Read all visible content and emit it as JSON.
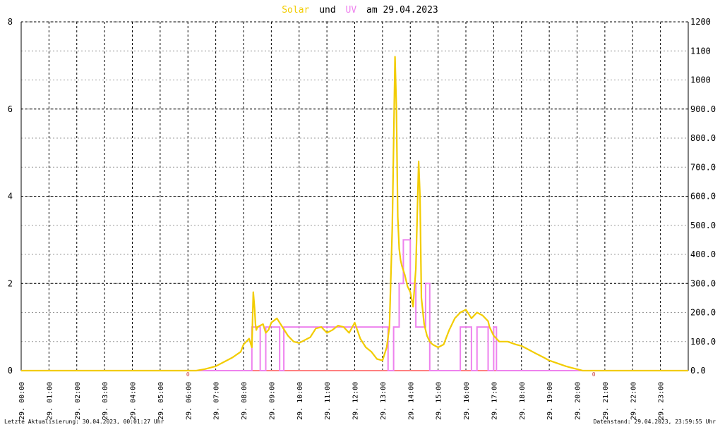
{
  "title": {
    "word1": "Solar",
    "word2": "und",
    "word3": "UV",
    "word4": "am 29.04.2023"
  },
  "footer": {
    "left": "Letzte Aktualisierung: 30.04.2023, 00:01:27 Uhr",
    "right": "Datenstand: 29.04.2023, 23:59:55 Uhr"
  },
  "colors": {
    "solar": "#f2cc00",
    "uv": "#ee82ee",
    "grid": "#000000",
    "baseline": "#ff8080",
    "title_neutral": "#000000"
  },
  "chart_data": {
    "type": "line",
    "title": "Solar und UV am 29.04.2023",
    "x_unit": "hour of day",
    "xlim": [
      0,
      24
    ],
    "x_tick_labels": [
      "29. 00:00",
      "29. 01:00",
      "29. 02:00",
      "29. 03:00",
      "29. 04:00",
      "29. 05:00",
      "29. 06:00",
      "29. 07:00",
      "29. 08:00",
      "29. 09:00",
      "29. 10:00",
      "29. 11:00",
      "29. 12:00",
      "29. 13:00",
      "29. 14:00",
      "29. 15:00",
      "29. 16:00",
      "29. 17:00",
      "29. 18:00",
      "29. 19:00",
      "29. 20:00",
      "29. 21:00",
      "29. 22:00",
      "29. 23:00"
    ],
    "left_axis": {
      "ylim": [
        0,
        8
      ],
      "ticks": [
        "0",
        "2",
        "4",
        "6",
        "8"
      ]
    },
    "right_axis": {
      "ylim": [
        0,
        1200
      ],
      "ticks": [
        "0.0",
        "100.0",
        "200.0",
        "300.0",
        "400.0",
        "500.0",
        "600.0",
        "700.0",
        "800.0",
        "900.0",
        "1000",
        "1100",
        "1200"
      ]
    },
    "grid": true,
    "annotations": [
      "0",
      "0"
    ],
    "series": [
      {
        "name": "Solar",
        "axis": "right",
        "x": [
          0,
          6.3,
          6.6,
          7.0,
          7.3,
          7.6,
          7.9,
          8.0,
          8.2,
          8.3,
          8.35,
          8.4,
          8.43,
          8.46,
          8.5,
          8.7,
          8.8,
          8.9,
          9.0,
          9.2,
          9.4,
          9.6,
          9.8,
          10.0,
          10.2,
          10.4,
          10.6,
          10.8,
          11.0,
          11.2,
          11.4,
          11.6,
          11.8,
          12.0,
          12.2,
          12.4,
          12.6,
          12.8,
          13.0,
          13.15,
          13.25,
          13.35,
          13.45,
          13.5,
          13.55,
          13.6,
          13.65,
          13.7,
          13.8,
          13.9,
          14.0,
          14.1,
          14.2,
          14.3,
          14.35,
          14.4,
          14.5,
          14.6,
          14.7,
          14.8,
          15.0,
          15.2,
          15.4,
          15.6,
          15.8,
          16.0,
          16.2,
          16.4,
          16.6,
          16.8,
          16.85,
          17.0,
          17.2,
          17.5,
          17.8,
          18.0,
          18.3,
          18.5,
          18.8,
          19.0,
          19.3,
          19.6,
          19.8,
          20.0,
          20.2,
          20.3,
          21.0,
          24.0
        ],
        "values": [
          0,
          0,
          5,
          15,
          30,
          45,
          65,
          90,
          110,
          80,
          270,
          210,
          160,
          140,
          150,
          160,
          130,
          140,
          165,
          180,
          150,
          120,
          100,
          95,
          105,
          115,
          145,
          150,
          130,
          140,
          155,
          150,
          130,
          165,
          110,
          80,
          65,
          40,
          35,
          80,
          150,
          490,
          1080,
          900,
          530,
          420,
          380,
          360,
          330,
          290,
          270,
          220,
          350,
          720,
          600,
          250,
          160,
          120,
          100,
          90,
          80,
          90,
          140,
          180,
          200,
          210,
          180,
          200,
          190,
          170,
          150,
          120,
          100,
          100,
          90,
          85,
          70,
          60,
          45,
          35,
          25,
          15,
          10,
          5,
          0,
          0,
          0,
          0
        ]
      },
      {
        "name": "UV",
        "axis": "left",
        "step": true,
        "x": [
          0,
          8.3,
          8.6,
          8.8,
          9.3,
          9.45,
          13.2,
          13.4,
          13.6,
          13.75,
          14.0,
          14.2,
          14.55,
          14.7,
          15.8,
          16.2,
          16.4,
          16.8,
          17.0,
          17.1,
          24.0
        ],
        "values": [
          0,
          1,
          0,
          1,
          0,
          1,
          0,
          1,
          2,
          3,
          2,
          1,
          2,
          0,
          1,
          0,
          1,
          0,
          1,
          0,
          0
        ]
      }
    ]
  }
}
